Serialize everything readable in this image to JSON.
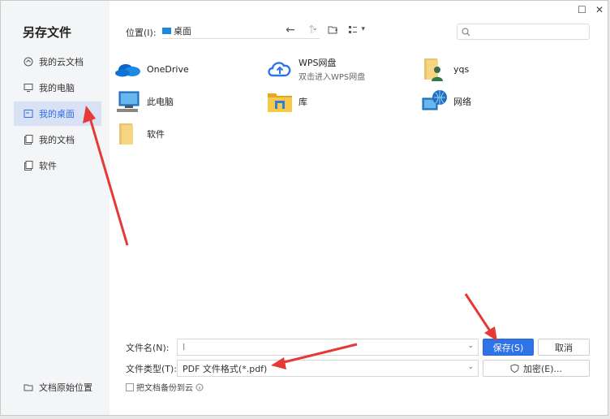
{
  "window": {
    "title": "另存文件",
    "maximize_glyph": "☐",
    "close_glyph": "✕"
  },
  "sidebar": {
    "items": [
      {
        "label": "我的云文档",
        "icon": "cloud-doc-icon"
      },
      {
        "label": "我的电脑",
        "icon": "computer-icon"
      },
      {
        "label": "我的桌面",
        "icon": "desktop-icon",
        "active": true
      },
      {
        "label": "我的文档",
        "icon": "document-icon"
      },
      {
        "label": "软件",
        "icon": "folder-icon"
      }
    ],
    "bottom_label": "文档原始位置"
  },
  "toolbar": {
    "location_label": "位置(I):",
    "location_value": "桌面",
    "back_glyph": "←",
    "up_glyph": "↑",
    "view_glyph": "▾"
  },
  "files": [
    {
      "name": "OneDrive",
      "icon": "onedrive-icon"
    },
    {
      "name": "WPS网盘",
      "subtitle": "双击进入WPS网盘",
      "icon": "wps-cloud-icon"
    },
    {
      "name": "yqs",
      "icon": "user-folder-icon"
    },
    {
      "name": "此电脑",
      "icon": "pc-icon"
    },
    {
      "name": "库",
      "icon": "library-icon"
    },
    {
      "name": "网络",
      "icon": "network-icon"
    },
    {
      "name": "软件",
      "icon": "folder-icon"
    }
  ],
  "form": {
    "filename_label": "文件名(N):",
    "filename_value": "I",
    "filetype_label": "文件类型(T):",
    "filetype_value": "PDF 文件格式(*.pdf)",
    "save_label": "保存(S)",
    "cancel_label": "取消",
    "encrypt_label": "加密(E)...",
    "backup_label": "把文档备份到云"
  },
  "colors": {
    "accent": "#2f73e8",
    "arrow": "#e53935",
    "active_bg": "#d9e2f4"
  }
}
